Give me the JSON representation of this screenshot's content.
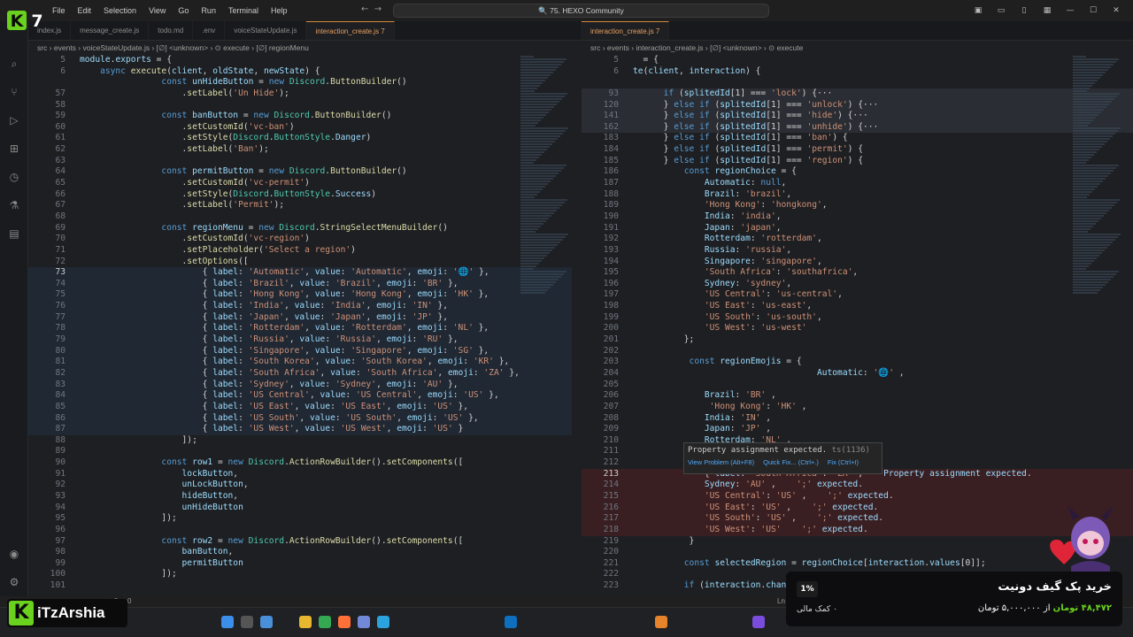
{
  "titlebar": {
    "menu": [
      "File",
      "Edit",
      "Selection",
      "View",
      "Go",
      "Run",
      "Terminal",
      "Help"
    ],
    "command_center": "75. HEXO Community"
  },
  "left_editor": {
    "tabs": [
      {
        "label": "index.js",
        "active": false
      },
      {
        "label": "message_create.js",
        "active": false
      },
      {
        "label": "todo.md",
        "active": false
      },
      {
        "label": ".env",
        "active": false
      },
      {
        "label": "voiceStateUpdate.js",
        "active": false
      },
      {
        "label": "interaction_create.js 7",
        "active": true
      }
    ],
    "breadcrumb": "src › events › voiceStateUpdate.js › [∅] <unknown> › ⊙ execute › [∅] regionMenu",
    "current_line": "73",
    "lines": [
      {
        "n": "5",
        "t": "module.exports = {"
      },
      {
        "n": "6",
        "t": "    async execute(client, oldState, newState) {"
      },
      {
        "n": "",
        "t": "                const unHideButton = new Discord.ButtonBuilder()"
      },
      {
        "n": "57",
        "t": "                    .setLabel('Un Hide');"
      },
      {
        "n": "58",
        "t": ""
      },
      {
        "n": "59",
        "t": "                const banButton = new Discord.ButtonBuilder()"
      },
      {
        "n": "60",
        "t": "                    .setCustomId('vc-ban')"
      },
      {
        "n": "61",
        "t": "                    .setStyle(Discord.ButtonStyle.Danger)"
      },
      {
        "n": "62",
        "t": "                    .setLabel('Ban');"
      },
      {
        "n": "63",
        "t": ""
      },
      {
        "n": "64",
        "t": "                const permitButton = new Discord.ButtonBuilder()"
      },
      {
        "n": "65",
        "t": "                    .setCustomId('vc-permit')"
      },
      {
        "n": "66",
        "t": "                    .setStyle(Discord.ButtonStyle.Success)"
      },
      {
        "n": "67",
        "t": "                    .setLabel('Permit');"
      },
      {
        "n": "68",
        "t": ""
      },
      {
        "n": "69",
        "t": "                const regionMenu = new Discord.StringSelectMenuBuilder()"
      },
      {
        "n": "70",
        "t": "                    .setCustomId('vc-region')"
      },
      {
        "n": "71",
        "t": "                    .setPlaceholder('Select a region')"
      },
      {
        "n": "72",
        "t": "                    .setOptions(["
      },
      {
        "n": "73",
        "t": "                        { label: 'Automatic', value: 'Automatic', emoji: '🌐' },"
      },
      {
        "n": "74",
        "t": "                        { label: 'Brazil', value: 'Brazil', emoji: 'BR' },"
      },
      {
        "n": "75",
        "t": "                        { label: 'Hong Kong', value: 'Hong Kong', emoji: 'HK' },"
      },
      {
        "n": "76",
        "t": "                        { label: 'India', value: 'India', emoji: 'IN' },"
      },
      {
        "n": "77",
        "t": "                        { label: 'Japan', value: 'Japan', emoji: 'JP' },"
      },
      {
        "n": "78",
        "t": "                        { label: 'Rotterdam', value: 'Rotterdam', emoji: 'NL' },"
      },
      {
        "n": "79",
        "t": "                        { label: 'Russia', value: 'Russia', emoji: 'RU' },"
      },
      {
        "n": "80",
        "t": "                        { label: 'Singapore', value: 'Singapore', emoji: 'SG' },"
      },
      {
        "n": "81",
        "t": "                        { label: 'South Korea', value: 'South Korea', emoji: 'KR' },"
      },
      {
        "n": "82",
        "t": "                        { label: 'South Africa', value: 'South Africa', emoji: 'ZA' },"
      },
      {
        "n": "83",
        "t": "                        { label: 'Sydney', value: 'Sydney', emoji: 'AU' },"
      },
      {
        "n": "84",
        "t": "                        { label: 'US Central', value: 'US Central', emoji: 'US' },"
      },
      {
        "n": "85",
        "t": "                        { label: 'US East', value: 'US East', emoji: 'US' },"
      },
      {
        "n": "86",
        "t": "                        { label: 'US South', value: 'US South', emoji: 'US' },"
      },
      {
        "n": "87",
        "t": "                        { label: 'US West', value: 'US West', emoji: 'US' }"
      },
      {
        "n": "88",
        "t": "                    ]);"
      },
      {
        "n": "89",
        "t": ""
      },
      {
        "n": "90",
        "t": "                const row1 = new Discord.ActionRowBuilder().setComponents(["
      },
      {
        "n": "91",
        "t": "                    lockButton,"
      },
      {
        "n": "92",
        "t": "                    unLockButton,"
      },
      {
        "n": "93",
        "t": "                    hideButton,"
      },
      {
        "n": "94",
        "t": "                    unHideButton"
      },
      {
        "n": "95",
        "t": "                ]);"
      },
      {
        "n": "96",
        "t": ""
      },
      {
        "n": "97",
        "t": "                const row2 = new Discord.ActionRowBuilder().setComponents(["
      },
      {
        "n": "98",
        "t": "                    banButton,"
      },
      {
        "n": "99",
        "t": "                    permitButton"
      },
      {
        "n": "100",
        "t": "                ]);"
      },
      {
        "n": "101",
        "t": ""
      }
    ]
  },
  "right_editor": {
    "tabs": [
      {
        "label": "interaction_create.js 7",
        "active": true
      }
    ],
    "breadcrumb": "src › events › interaction_create.js › [∅] <unknown> › ⊙ execute",
    "current_line": "213",
    "lines": [
      {
        "n": "5",
        "t": "  = {"
      },
      {
        "n": "6",
        "t": "te(client, interaction) {"
      },
      {
        "n": "",
        "t": ""
      },
      {
        "n": "93",
        "t": "      if (splitedId[1] === 'lock') {···"
      },
      {
        "n": "120",
        "t": "      } else if (splitedId[1] === 'unlock') {···"
      },
      {
        "n": "141",
        "t": "      } else if (splitedId[1] === 'hide') {···"
      },
      {
        "n": "162",
        "t": "      } else if (splitedId[1] === 'unhide') {···"
      },
      {
        "n": "183",
        "t": "      } else if (splitedId[1] === 'ban') {"
      },
      {
        "n": "184",
        "t": "      } else if (splitedId[1] === 'permit') {"
      },
      {
        "n": "185",
        "t": "      } else if (splitedId[1] === 'region') {"
      },
      {
        "n": "186",
        "t": "          const regionChoice = {"
      },
      {
        "n": "187",
        "t": "              Automatic: null,"
      },
      {
        "n": "188",
        "t": "              Brazil: 'brazil',"
      },
      {
        "n": "189",
        "t": "              'Hong Kong': 'hongkong',"
      },
      {
        "n": "190",
        "t": "              India: 'india',"
      },
      {
        "n": "191",
        "t": "              Japan: 'japan',"
      },
      {
        "n": "192",
        "t": "              Rotterdam: 'rotterdam',"
      },
      {
        "n": "193",
        "t": "              Russia: 'russia',"
      },
      {
        "n": "194",
        "t": "              Singapore: 'singapore',"
      },
      {
        "n": "195",
        "t": "              'South Africa': 'southafrica',"
      },
      {
        "n": "196",
        "t": "              Sydney: 'sydney',"
      },
      {
        "n": "197",
        "t": "              'US Central': 'us-central',"
      },
      {
        "n": "198",
        "t": "              'US East': 'us-east',"
      },
      {
        "n": "199",
        "t": "              'US South': 'us-south',"
      },
      {
        "n": "200",
        "t": "              'US West': 'us-west'"
      },
      {
        "n": "201",
        "t": "          };"
      },
      {
        "n": "202",
        "t": ""
      },
      {
        "n": "203",
        "t": "           const regionEmojis = {"
      },
      {
        "n": "204",
        "t": "                                    Automatic: '🌐' ,"
      },
      {
        "n": "205",
        "t": ""
      },
      {
        "n": "206",
        "t": "              Brazil: 'BR' ,"
      },
      {
        "n": "207",
        "t": "               'Hong Kong': 'HK' ,"
      },
      {
        "n": "208",
        "t": "              India: 'IN' ,"
      },
      {
        "n": "209",
        "t": "              Japan: 'JP' ,"
      },
      {
        "n": "210",
        "t": "              Rotterdam: 'NL' ,"
      },
      {
        "n": "211",
        "t": ""
      },
      {
        "n": "212",
        "t": ""
      },
      {
        "n": "213",
        "t": "              { label: 'South Africa': 'ZA' ,    Property assignment expected."
      },
      {
        "n": "214",
        "t": "              Sydney: 'AU' ,    ';' expected."
      },
      {
        "n": "215",
        "t": "              'US Central': 'US' ,    ';' expected."
      },
      {
        "n": "216",
        "t": "              'US East': 'US' ,    ';' expected."
      },
      {
        "n": "217",
        "t": "              'US South': 'US' ,    ';' expected."
      },
      {
        "n": "218",
        "t": "              'US West': 'US'    ';' expected."
      },
      {
        "n": "219",
        "t": "           }"
      },
      {
        "n": "220",
        "t": ""
      },
      {
        "n": "221",
        "t": "          const selectedRegion = regionChoice[interaction.values[0]];"
      },
      {
        "n": "222",
        "t": ""
      },
      {
        "n": "223",
        "t": "          if (interaction.channel."
      }
    ]
  },
  "hover": {
    "message": "Property assignment expected.",
    "code": "ts(1136)",
    "actions": [
      "View Problem (Alt+F8)",
      "Quick Fix... (Ctrl+.)",
      "Fix (Ctrl+I)"
    ]
  },
  "status": {
    "left": "⊗ 0 △ 0",
    "right": "Ln"
  },
  "overlay": {
    "logo_number": "7",
    "brand_name": "iTzArshia",
    "donate_title": "خرید پک گیف دونیت",
    "donate_amount_paid": "۴۸,۴۷۲ تومان",
    "donate_amount_goal": "از ۵,۰۰۰,۰۰۰ تومان",
    "donate_percent": "1%",
    "donate_count": "۰ کمک مالی"
  },
  "colors": {
    "accent_tab": "#e8a060",
    "brand_green": "#6ad11e",
    "error": "#f14c4c"
  }
}
